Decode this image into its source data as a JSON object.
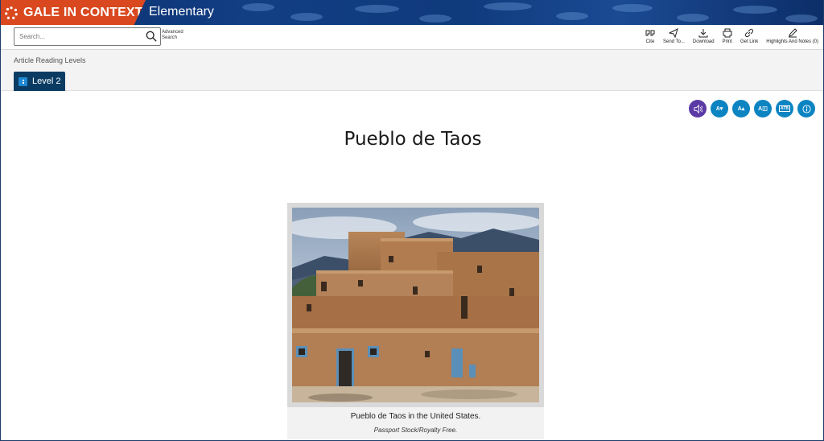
{
  "banner": {
    "brand": "GALE IN CONTEXT",
    "product": "Elementary",
    "colors": {
      "brand_bg": "#d9481e",
      "banner_bg": "#0f3a7c"
    }
  },
  "search": {
    "placeholder": "Search...",
    "advanced_label": "Advanced Search"
  },
  "tools": [
    {
      "label": "Cite",
      "icon": "quote-icon"
    },
    {
      "label": "Send To...",
      "icon": "send-icon"
    },
    {
      "label": "Download",
      "icon": "download-icon"
    },
    {
      "label": "Print",
      "icon": "print-icon"
    },
    {
      "label": "Get Link",
      "icon": "link-icon"
    },
    {
      "label": "Highlights And Notes (0)",
      "icon": "pencil-icon"
    }
  ],
  "reading_levels": {
    "label": "Article Reading Levels",
    "current": "Level 2"
  },
  "reader_controls": {
    "font_smaller": "A",
    "font_larger": "A",
    "font_style": "A",
    "translate": "ATB"
  },
  "article": {
    "title": "Pueblo de Taos"
  },
  "figure": {
    "caption": "Pueblo de Taos in the United States.",
    "credit": "Passport Stock/Royalty Free."
  }
}
